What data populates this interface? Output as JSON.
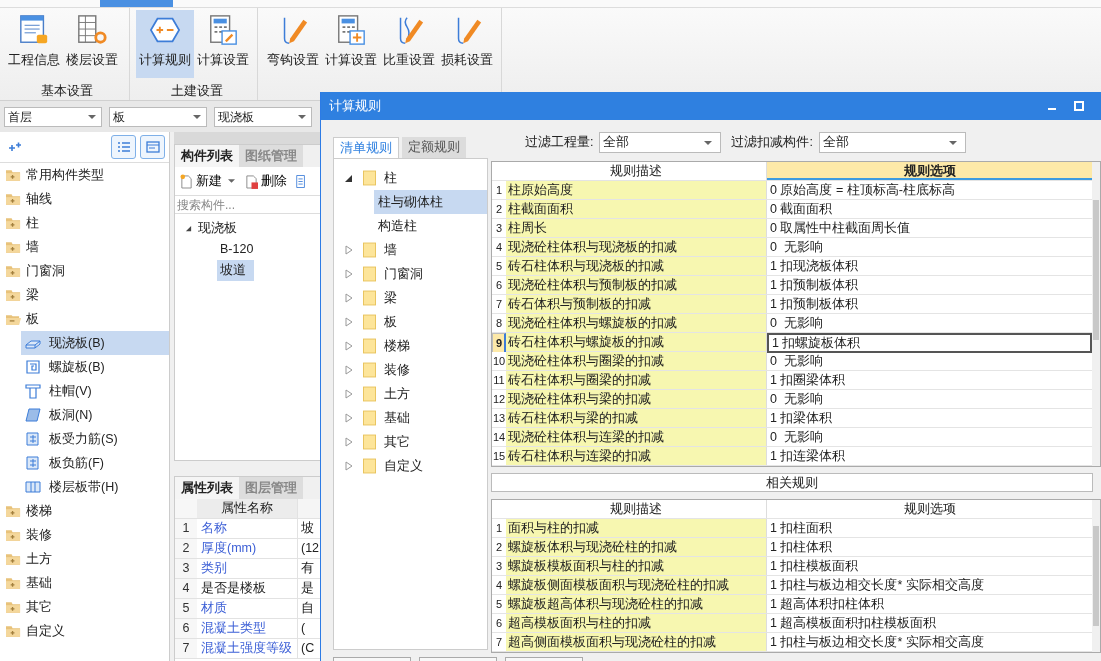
{
  "ribbon": {
    "groups": [
      {
        "label": "基本设置",
        "buttons": [
          {
            "label": "工程信息",
            "selected": false
          },
          {
            "label": "楼层设置",
            "selected": false
          }
        ]
      },
      {
        "label": "土建设置",
        "buttons": [
          {
            "label": "计算规则",
            "selected": true
          },
          {
            "label": "计算设置",
            "selected": false
          }
        ]
      },
      {
        "buttons": [
          {
            "label": "弯钩设置",
            "selected": false
          },
          {
            "label": "计算设置",
            "selected": false
          },
          {
            "label": "比重设置",
            "selected": false
          },
          {
            "label": "损耗设置",
            "selected": false
          }
        ]
      }
    ]
  },
  "selectors": [
    {
      "value": "首层"
    },
    {
      "value": "板"
    },
    {
      "value": "现浇板"
    }
  ],
  "component_tree": [
    {
      "label": "常用构件类型",
      "expanded": false
    },
    {
      "label": "轴线",
      "expanded": false
    },
    {
      "label": "柱",
      "expanded": false
    },
    {
      "label": "墙",
      "expanded": false
    },
    {
      "label": "门窗洞",
      "expanded": false
    },
    {
      "label": "梁",
      "expanded": false
    },
    {
      "label": "板",
      "expanded": true,
      "children": [
        {
          "label": "现浇板(B)",
          "selected": true
        },
        {
          "label": "螺旋板(B)",
          "selected": false
        },
        {
          "label": "柱帽(V)",
          "selected": false
        },
        {
          "label": "板洞(N)",
          "selected": false
        },
        {
          "label": "板受力筋(S)",
          "selected": false
        },
        {
          "label": "板负筋(F)",
          "selected": false
        },
        {
          "label": "楼层板带(H)",
          "selected": false
        }
      ]
    },
    {
      "label": "楼梯",
      "expanded": false
    },
    {
      "label": "装修",
      "expanded": false
    },
    {
      "label": "土方",
      "expanded": false
    },
    {
      "label": "基础",
      "expanded": false
    },
    {
      "label": "其它",
      "expanded": false
    },
    {
      "label": "自定义",
      "expanded": false
    }
  ],
  "component_list": {
    "tabs": [
      {
        "label": "构件列表",
        "selected": true
      },
      {
        "label": "图纸管理",
        "selected": false
      }
    ],
    "toolbar": [
      "新建",
      "删除"
    ],
    "search": {
      "placeholder": "搜索构件..."
    },
    "tree": [
      {
        "label": "现浇板",
        "expanded": true,
        "children": [
          {
            "label": "B-120",
            "selected": false
          },
          {
            "label": "坡道",
            "selected": true
          }
        ]
      }
    ]
  },
  "property_list": {
    "tabs": [
      {
        "label": "属性列表",
        "selected": true
      },
      {
        "label": "图层管理",
        "selected": false
      }
    ],
    "columns": [
      "属性名称"
    ],
    "rows": [
      {
        "index": "1",
        "name": "名称",
        "value": "坡",
        "public": true
      },
      {
        "index": "2",
        "name": "厚度(mm)",
        "value": "(12",
        "public": true
      },
      {
        "index": "3",
        "name": "类别",
        "value": "有",
        "public": true
      },
      {
        "index": "4",
        "name": "是否是楼板",
        "value": "是",
        "public": false
      },
      {
        "index": "5",
        "name": "材质",
        "value": "自",
        "public": true
      },
      {
        "index": "6",
        "name": "混凝土类型",
        "value": "(",
        "public": true
      },
      {
        "index": "7",
        "name": "混凝土强度等级",
        "value": "(C",
        "public": true
      }
    ]
  },
  "dialog": {
    "title": "计算规则",
    "tabs": [
      {
        "label": "清单规则",
        "selected": true
      },
      {
        "label": "定额规则",
        "selected": false
      }
    ],
    "filters": [
      {
        "label": "过滤工程量:",
        "value": "全部"
      },
      {
        "label": "过滤扣减构件:",
        "value": "全部"
      }
    ],
    "tree": [
      {
        "label": "柱",
        "expanded": true,
        "children": [
          {
            "label": "柱与砌体柱",
            "selected": true
          },
          {
            "label": "构造柱",
            "selected": false
          }
        ]
      },
      {
        "label": "墙",
        "expanded": false
      },
      {
        "label": "门窗洞",
        "expanded": false
      },
      {
        "label": "梁",
        "expanded": false
      },
      {
        "label": "板",
        "expanded": false
      },
      {
        "label": "楼梯",
        "expanded": false
      },
      {
        "label": "装修",
        "expanded": false
      },
      {
        "label": "土方",
        "expanded": false
      },
      {
        "label": "基础",
        "expanded": false
      },
      {
        "label": "其它",
        "expanded": false
      },
      {
        "label": "自定义",
        "expanded": false
      }
    ],
    "rules": {
      "columns": [
        "规则描述",
        "规则选项"
      ],
      "rows": [
        {
          "index": "1",
          "description": "柱原始高度",
          "option": "0 原始高度 = 柱顶标高-柱底标高",
          "selected": false
        },
        {
          "index": "2",
          "description": "柱截面面积",
          "option": "0 截面面积",
          "selected": false
        },
        {
          "index": "3",
          "description": "柱周长",
          "option": "0 取属性中柱截面周长值",
          "selected": false
        },
        {
          "index": "4",
          "description": "现浇砼柱体积与现浇板的扣减",
          "option": "0  无影响",
          "selected": false
        },
        {
          "index": "5",
          "description": "砖石柱体积与现浇板的扣减",
          "option": "1 扣现浇板体积",
          "selected": false
        },
        {
          "index": "6",
          "description": "现浇砼柱体积与预制板的扣减",
          "option": "1 扣预制板体积",
          "selected": false
        },
        {
          "index": "7",
          "description": "砖石体积与预制板的扣减",
          "option": "1 扣预制板体积",
          "selected": false
        },
        {
          "index": "8",
          "description": "现浇砼柱体积与螺旋板的扣减",
          "option": "0  无影响",
          "selected": false
        },
        {
          "index": "9",
          "description": "砖石柱体积与螺旋板的扣减",
          "option": "1 扣螺旋板体积",
          "selected": true
        },
        {
          "index": "10",
          "description": "现浇砼柱体积与圈梁的扣减",
          "option": "0  无影响",
          "selected": false
        },
        {
          "index": "11",
          "description": "砖石柱体积与圈梁的扣减",
          "option": "1 扣圈梁体积",
          "selected": false
        },
        {
          "index": "12",
          "description": "现浇砼柱体积与梁的扣减",
          "option": "0  无影响",
          "selected": false
        },
        {
          "index": "13",
          "description": "砖石柱体积与梁的扣减",
          "option": "1 扣梁体积",
          "selected": false
        },
        {
          "index": "14",
          "description": "现浇砼柱体积与连梁的扣减",
          "option": "0  无影响",
          "selected": false
        },
        {
          "index": "15",
          "description": "砖石柱体积与连梁的扣减",
          "option": "1 扣连梁体积",
          "selected": false
        }
      ]
    },
    "related_title": "相关规则",
    "related_rules": {
      "columns": [
        "规则描述",
        "规则选项"
      ],
      "rows": [
        {
          "index": "1",
          "description": "面积与柱的扣减",
          "option": "1 扣柱面积"
        },
        {
          "index": "2",
          "description": "螺旋板体积与现浇砼柱的扣减",
          "option": "1 扣柱体积"
        },
        {
          "index": "3",
          "description": "螺旋板模板面积与柱的扣减",
          "option": "1 扣柱模板面积"
        },
        {
          "index": "4",
          "description": "螺旋板侧面模板面积与现浇砼柱的扣减",
          "option": "1 扣柱与板边相交长度* 实际相交高度"
        },
        {
          "index": "5",
          "description": "螺旋板超高体积与现浇砼柱的扣减",
          "option": "1 超高体积扣柱体积"
        },
        {
          "index": "6",
          "description": "超高模板面积与柱的扣减",
          "option": "1 超高模板面积扣柱模板面积"
        },
        {
          "index": "7",
          "description": "超高侧面模板面积与现浇砼柱的扣减",
          "option": "1 扣柱与板边相交长度* 实际相交高度"
        }
      ]
    }
  }
}
